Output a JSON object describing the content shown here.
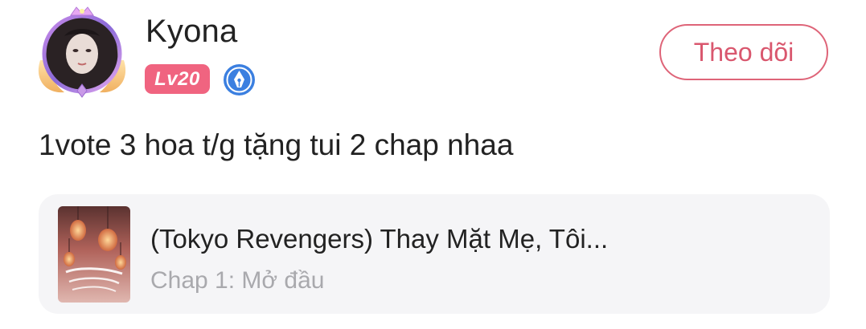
{
  "user": {
    "name": "Kyona",
    "level": "Lv20",
    "avatar_icon": "avatar-portrait-with-decorative-frame",
    "author_badge_icon": "pen-nib-badge-icon"
  },
  "actions": {
    "follow_label": "Theo dõi"
  },
  "comment": {
    "text": "1vote 3 hoa t/g tặng tui 2 chap nhaa"
  },
  "book": {
    "title": "(Tokyo Revengers) Thay Mặt Mẹ, Tôi...",
    "chapter": "Chap 1: Mở đầu",
    "cover_icon": "book-cover-lanterns-image"
  },
  "colors": {
    "level_badge": "#f06480",
    "follow_border": "#de6478",
    "follow_text": "#d9576e",
    "card_background": "#f5f5f7",
    "chapter_text": "#a9a9ad",
    "author_badge": "#3b7fe0"
  }
}
